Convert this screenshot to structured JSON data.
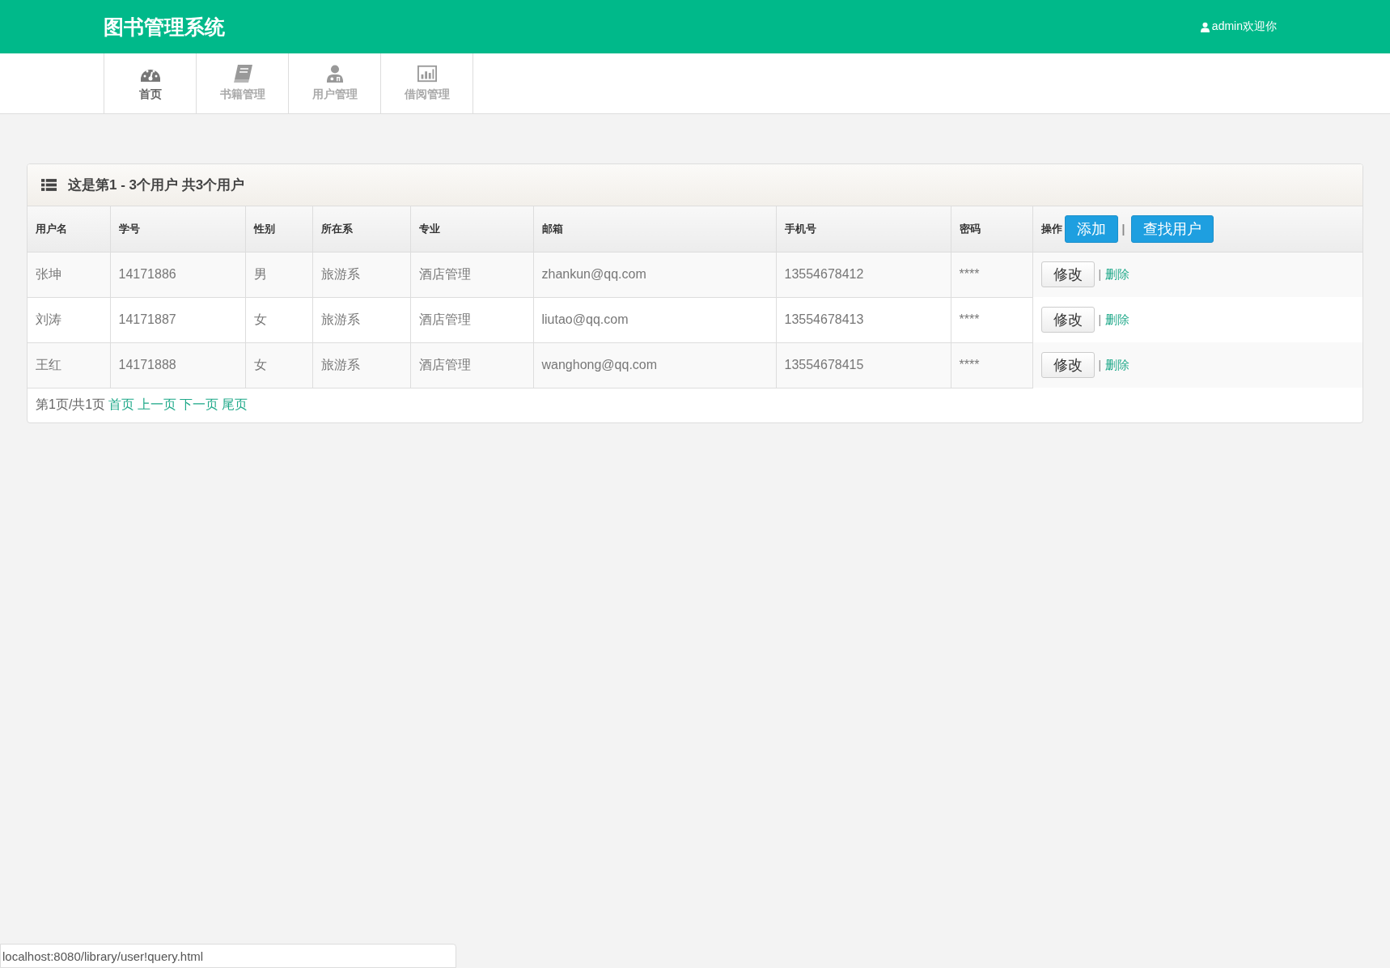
{
  "header": {
    "title": "图书管理系统",
    "user": "admin欢迎你"
  },
  "nav": [
    {
      "label": "首页",
      "selected": true
    },
    {
      "label": "书籍管理",
      "selected": false
    },
    {
      "label": "用户管理",
      "selected": false
    },
    {
      "label": "借阅管理",
      "selected": false
    }
  ],
  "panel": {
    "title": "这是第1 - 3个用户 共3个用户"
  },
  "table": {
    "columns": [
      "用户名",
      "学号",
      "性别",
      "所在系",
      "专业",
      "邮箱",
      "手机号",
      "密码"
    ],
    "action_column": {
      "label": "操作",
      "buttons": [
        "添加",
        "查找用户"
      ],
      "separator": "|"
    },
    "rows": [
      {
        "cells": [
          "张坤",
          "14171886",
          "男",
          "旅游系",
          "酒店管理",
          "zhankun@qq.com",
          "13554678412",
          "****"
        ],
        "edit": "修改",
        "separator": "|",
        "delete": "删除"
      },
      {
        "cells": [
          "刘涛",
          "14171887",
          "女",
          "旅游系",
          "酒店管理",
          "liutao@qq.com",
          "13554678413",
          "****"
        ],
        "edit": "修改",
        "separator": "|",
        "delete": "删除"
      },
      {
        "cells": [
          "王红",
          "14171888",
          "女",
          "旅游系",
          "酒店管理",
          "wanghong@qq.com",
          "13554678415",
          "****"
        ],
        "edit": "修改",
        "separator": "|",
        "delete": "删除"
      }
    ]
  },
  "pagination": {
    "status": "第1页/共1页",
    "links": [
      "首页",
      "上一页",
      "下一页",
      "尾页"
    ]
  },
  "status_bar": {
    "url": "localhost:8080/library/user!query.html"
  }
}
